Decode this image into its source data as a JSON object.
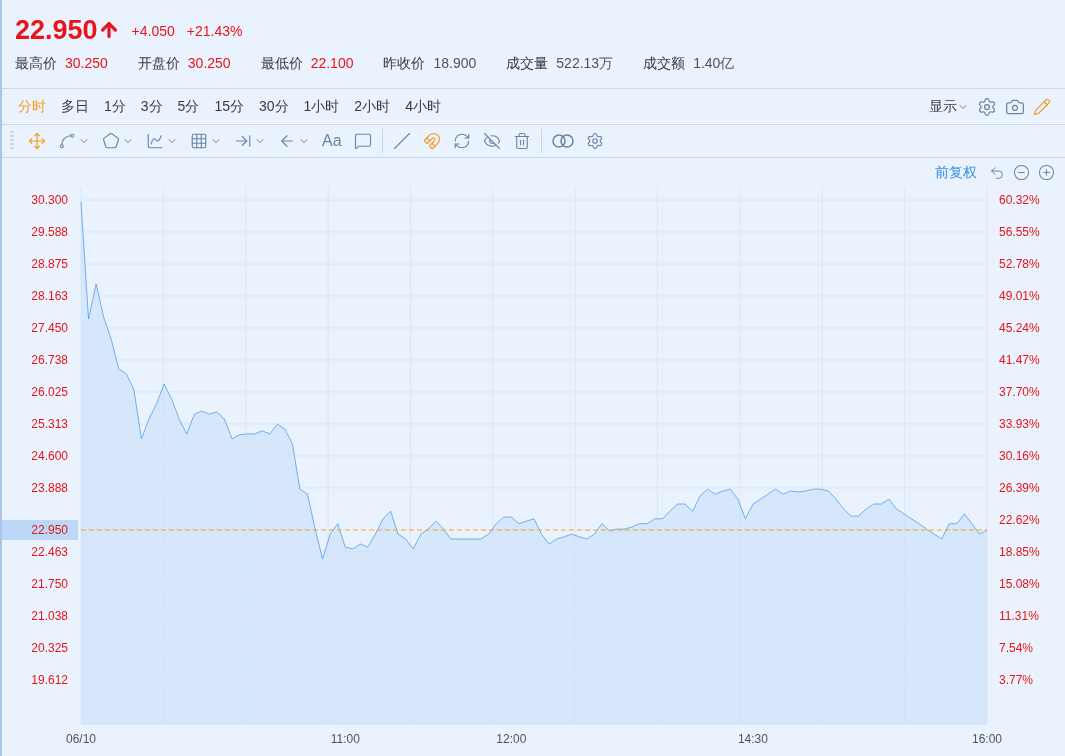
{
  "quote": {
    "price": "22.950",
    "color": "#e8141a",
    "change": "+4.050",
    "change_pct": "+21.43%"
  },
  "stats": [
    {
      "label": "最高价",
      "value": "30.250",
      "color": "#e8141a"
    },
    {
      "label": "开盘价",
      "value": "30.250",
      "color": "#e8141a"
    },
    {
      "label": "最低价",
      "value": "22.100",
      "color": "#e8141a"
    },
    {
      "label": "昨收价",
      "value": "18.900",
      "color": "#4a5563"
    },
    {
      "label": "成交量",
      "value": "522.13万",
      "color": "#4a5563"
    },
    {
      "label": "成交额",
      "value": "1.40亿",
      "color": "#4a5563"
    }
  ],
  "periods": [
    {
      "label": "分时",
      "selected": true
    },
    {
      "label": "多日",
      "selected": false
    },
    {
      "label": "1分",
      "selected": false
    },
    {
      "label": "3分",
      "selected": false
    },
    {
      "label": "5分",
      "selected": false
    },
    {
      "label": "15分",
      "selected": false
    },
    {
      "label": "30分",
      "selected": false
    },
    {
      "label": "1小时",
      "selected": false
    },
    {
      "label": "2小时",
      "selected": false
    },
    {
      "label": "4小时",
      "selected": false
    }
  ],
  "display_menu": {
    "label": "显示"
  },
  "tools": [
    {
      "kind": "move",
      "active": true,
      "dropdown": false
    },
    {
      "kind": "segment",
      "active": false,
      "dropdown": true
    },
    {
      "kind": "polygon",
      "active": false,
      "dropdown": true
    },
    {
      "kind": "wave",
      "active": false,
      "dropdown": true
    },
    {
      "kind": "grid",
      "active": false,
      "dropdown": true
    },
    {
      "kind": "measure",
      "active": false,
      "dropdown": true
    },
    {
      "kind": "arrow",
      "active": false,
      "dropdown": true
    },
    {
      "kind": "text",
      "label": "Aa",
      "active": false,
      "dropdown": false
    },
    {
      "kind": "comment",
      "active": false,
      "dropdown": false
    },
    {
      "kind": "divider"
    },
    {
      "kind": "angle",
      "active": false,
      "dropdown": false
    },
    {
      "kind": "magnet",
      "active": true,
      "dropdown": false
    },
    {
      "kind": "sync",
      "active": false,
      "dropdown": false
    },
    {
      "kind": "hide",
      "active": false,
      "dropdown": false
    },
    {
      "kind": "trash",
      "active": false,
      "dropdown": false
    },
    {
      "kind": "divider"
    },
    {
      "kind": "compare",
      "active": false,
      "dropdown": false
    },
    {
      "kind": "settings",
      "active": false,
      "dropdown": false
    }
  ],
  "chart": {
    "adjust_label": "前复权",
    "percent_labels": [
      "60.32%",
      "56.55%",
      "52.78%",
      "49.01%",
      "45.24%",
      "41.47%",
      "37.70%",
      "33.93%",
      "30.16%",
      "26.39%",
      "22.62%",
      "18.85%",
      "15.08%",
      "11.31%",
      "7.54%",
      "3.77%"
    ],
    "chart_data": {
      "type": "area",
      "grid": true,
      "categories": [
        "06/10",
        null,
        null,
        null,
        null,
        null,
        null,
        null,
        null,
        null,
        null,
        null,
        null,
        null,
        null,
        null,
        null,
        null,
        null,
        null,
        null,
        null,
        null,
        null,
        null,
        null,
        null,
        null,
        null,
        null,
        null,
        null,
        null,
        null,
        null,
        "11:00",
        null,
        null,
        null,
        null,
        null,
        null,
        null,
        null,
        null,
        null,
        null,
        null,
        null,
        null,
        null,
        null,
        null,
        null,
        null,
        null,
        null,
        "12:00",
        null,
        null,
        null,
        null,
        null,
        null,
        null,
        null,
        null,
        null,
        null,
        null,
        null,
        null,
        null,
        null,
        null,
        null,
        null,
        null,
        null,
        null,
        null,
        null,
        null,
        null,
        null,
        null,
        null,
        null,
        null,
        "14:30",
        null,
        null,
        null,
        null,
        null,
        null,
        null,
        null,
        null,
        null,
        null,
        null,
        null,
        null,
        null,
        null,
        null,
        null,
        null,
        null,
        null,
        null,
        null,
        null,
        null,
        null,
        null,
        null,
        null,
        null,
        "16:00"
      ],
      "ylim": [
        18.63,
        30.59
      ],
      "yticks": [
        {
          "value": 30.3,
          "label": "30.300"
        },
        {
          "value": 29.588,
          "label": "29.588"
        },
        {
          "value": 28.875,
          "label": "28.875"
        },
        {
          "value": 28.163,
          "label": "28.163"
        },
        {
          "value": 27.45,
          "label": "27.450"
        },
        {
          "value": 26.738,
          "label": "26.738"
        },
        {
          "value": 26.025,
          "label": "26.025"
        },
        {
          "value": 25.313,
          "label": "25.313"
        },
        {
          "value": 24.6,
          "label": "24.600"
        },
        {
          "value": 23.888,
          "label": "23.888"
        },
        {
          "value": 22.463,
          "label": "22.463"
        },
        {
          "value": 21.75,
          "label": "21.750"
        },
        {
          "value": 21.038,
          "label": "21.038"
        },
        {
          "value": 20.325,
          "label": "20.325"
        },
        {
          "value": 19.612,
          "label": "19.612"
        }
      ],
      "ref_lines": [
        {
          "axis": "y",
          "value": 22.95,
          "label": "22.950",
          "color": "#f5a623"
        }
      ],
      "series": [
        {
          "color": "#1e88e5",
          "values": [
            30.26,
            27.65,
            28.43,
            27.69,
            27.2,
            26.54,
            26.43,
            26.09,
            24.98,
            25.42,
            25.76,
            26.2,
            25.87,
            25.42,
            25.09,
            25.53,
            25.6,
            25.53,
            25.58,
            25.42,
            24.98,
            25.07,
            25.09,
            25.09,
            25.16,
            25.09,
            25.31,
            25.2,
            24.87,
            23.86,
            23.75,
            22.97,
            22.31,
            22.86,
            23.09,
            22.57,
            22.53,
            22.64,
            22.57,
            22.86,
            23.2,
            23.37,
            22.86,
            22.75,
            22.53,
            22.86,
            22.97,
            23.15,
            22.97,
            22.75,
            22.75,
            22.75,
            22.75,
            22.75,
            22.86,
            23.09,
            23.24,
            23.24,
            23.09,
            23.15,
            23.2,
            22.86,
            22.64,
            22.75,
            22.8,
            22.86,
            22.8,
            22.75,
            22.86,
            23.09,
            22.93,
            22.97,
            22.97,
            23.02,
            23.09,
            23.09,
            23.2,
            23.2,
            23.37,
            23.53,
            23.53,
            23.37,
            23.71,
            23.86,
            23.75,
            23.82,
            23.86,
            23.64,
            23.2,
            23.53,
            23.64,
            23.75,
            23.86,
            23.75,
            23.82,
            23.8,
            23.82,
            23.86,
            23.86,
            23.82,
            23.64,
            23.42,
            23.26,
            23.26,
            23.42,
            23.53,
            23.53,
            23.64,
            23.42,
            23.31,
            23.2,
            23.09,
            22.97,
            22.86,
            22.75,
            23.09,
            23.09,
            23.31,
            23.09,
            22.86,
            22.95
          ]
        }
      ]
    }
  }
}
